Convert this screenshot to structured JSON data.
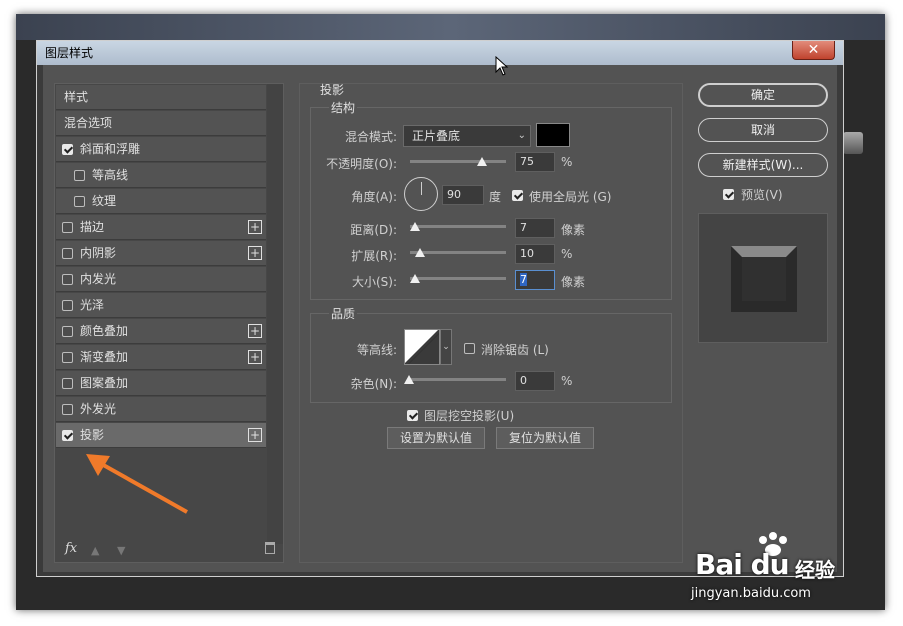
{
  "dialog": {
    "title": "图层样式",
    "close_label": "✕"
  },
  "left_list": {
    "items": [
      {
        "label": "样式",
        "has_checkbox": false,
        "checked": false,
        "has_plus": false,
        "indent": false
      },
      {
        "label": "混合选项",
        "has_checkbox": false,
        "checked": false,
        "has_plus": false,
        "indent": false
      },
      {
        "label": "斜面和浮雕",
        "has_checkbox": true,
        "checked": true,
        "has_plus": false,
        "indent": false
      },
      {
        "label": "等高线",
        "has_checkbox": true,
        "checked": false,
        "has_plus": false,
        "indent": true
      },
      {
        "label": "纹理",
        "has_checkbox": true,
        "checked": false,
        "has_plus": false,
        "indent": true
      },
      {
        "label": "描边",
        "has_checkbox": true,
        "checked": false,
        "has_plus": true,
        "indent": false
      },
      {
        "label": "内阴影",
        "has_checkbox": true,
        "checked": false,
        "has_plus": true,
        "indent": false
      },
      {
        "label": "内发光",
        "has_checkbox": true,
        "checked": false,
        "has_plus": false,
        "indent": false
      },
      {
        "label": "光泽",
        "has_checkbox": true,
        "checked": false,
        "has_plus": false,
        "indent": false
      },
      {
        "label": "颜色叠加",
        "has_checkbox": true,
        "checked": false,
        "has_plus": true,
        "indent": false
      },
      {
        "label": "渐变叠加",
        "has_checkbox": true,
        "checked": false,
        "has_plus": true,
        "indent": false
      },
      {
        "label": "图案叠加",
        "has_checkbox": true,
        "checked": false,
        "has_plus": false,
        "indent": false
      },
      {
        "label": "外发光",
        "has_checkbox": true,
        "checked": false,
        "has_plus": false,
        "indent": false
      },
      {
        "label": "投影",
        "has_checkbox": true,
        "checked": true,
        "has_plus": true,
        "indent": false,
        "selected": true
      }
    ],
    "footer": {
      "fx_label": "fx"
    }
  },
  "drop_shadow": {
    "section_title": "投影",
    "structure": {
      "title": "结构",
      "blend_mode_label": "混合模式:",
      "blend_mode_value": "正片叠底",
      "shadow_color": "#000000",
      "opacity_label": "不透明度(O):",
      "opacity_value": "75",
      "opacity_unit": "%",
      "angle_label": "角度(A):",
      "angle_value": "90",
      "angle_unit": "度",
      "global_light_label": "使用全局光 (G)",
      "global_light_checked": true,
      "distance_label": "距离(D):",
      "distance_value": "7",
      "distance_unit": "像素",
      "spread_label": "扩展(R):",
      "spread_value": "10",
      "spread_unit": "%",
      "size_label": "大小(S):",
      "size_value": "7",
      "size_unit": "像素"
    },
    "quality": {
      "title": "品质",
      "contour_label": "等高线:",
      "anti_alias_label": "消除锯齿 (L)",
      "anti_alias_checked": false,
      "noise_label": "杂色(N):",
      "noise_value": "0",
      "noise_unit": "%"
    },
    "knockout_label": "图层挖空投影(U)",
    "knockout_checked": true,
    "make_default_label": "设置为默认值",
    "reset_default_label": "复位为默认值"
  },
  "right_panel": {
    "ok_label": "确定",
    "cancel_label": "取消",
    "new_style_label": "新建样式(W)...",
    "preview_label": "预览(V)",
    "preview_checked": true
  },
  "watermark": {
    "brand": "Bai  du",
    "extra": "经验",
    "url": "jingyan.baidu.com"
  },
  "colors": {
    "dialog_bg": "#535353",
    "annotation_arrow": "#f07a2a",
    "selected_row": "#6a6a6a"
  }
}
